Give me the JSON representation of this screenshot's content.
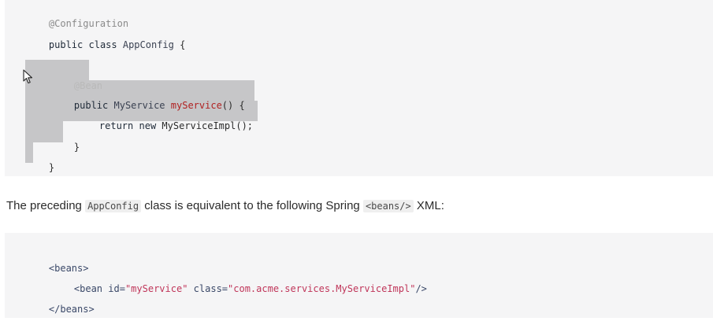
{
  "java_code": {
    "line_1": "@Configuration",
    "line_2_kw1": "public",
    "line_2_kw2": "class",
    "line_2_name": "AppConfig",
    "line_2_brace": "{",
    "line_3_annotation": "@Bean",
    "line_4_kw": "public",
    "line_4_type": "MyService",
    "line_4_method": "myService",
    "line_4_rest": "() {",
    "line_5_kw1": "return",
    "line_5_kw2": "new",
    "line_5_rest": "MyServiceImpl();",
    "line_6": "}",
    "line_7": "}"
  },
  "prose": {
    "part_1": "The preceding ",
    "code_1": "AppConfig",
    "part_2": " class is equivalent to the following Spring ",
    "code_2": "<beans/>",
    "part_3": " XML:"
  },
  "xml_code": {
    "line_1": "<beans>",
    "line_2_open": "<bean",
    "line_2_attr1": "id=",
    "line_2_val1": "\"myService\"",
    "line_2_attr2": "class=",
    "line_2_val2": "\"com.acme.services.MyServiceImpl\"",
    "line_2_close": "/>",
    "line_3": "</beans>"
  },
  "colors": {
    "code_background": "#f5f5f6",
    "selection": "#c6c6c8",
    "method_name": "#b02121",
    "xml_string": "#c0365a"
  },
  "icons": {
    "cursor": "mouse-pointer-icon"
  }
}
